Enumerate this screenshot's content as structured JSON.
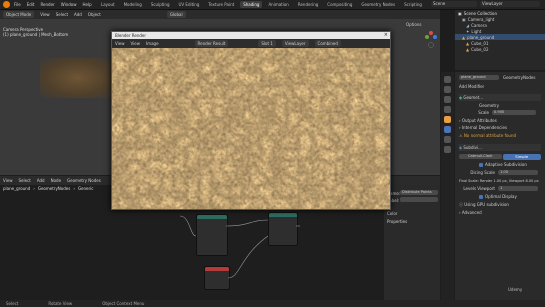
{
  "topbar": {
    "menu": [
      "File",
      "Edit",
      "Render",
      "Window",
      "Help"
    ],
    "workspaces": [
      "Layout",
      "Modeling",
      "Sculpting",
      "UV Editing",
      "Texture Paint",
      "Shading",
      "Animation",
      "Rendering",
      "Compositing",
      "Geometry Nodes",
      "Scripting"
    ],
    "active_workspace": "Shading",
    "scene": "Scene",
    "view_layer": "ViewLayer"
  },
  "viewport": {
    "header_items": [
      "Object Mode",
      "View",
      "Select",
      "Add",
      "Object"
    ],
    "transform": "Global",
    "info_line1": "Camera Perspective",
    "info_line2": "(1) plane_ground | Mesh_Bottom",
    "options_label": "Options"
  },
  "render_window": {
    "title": "Blender Render",
    "header_items": [
      "View",
      "View",
      "Image"
    ],
    "image_name": "Render Result",
    "slot": "Slot 1",
    "view_layer": "ViewLayer",
    "pass": "Combined"
  },
  "node_editor": {
    "header_items": [
      "View",
      "Select",
      "Add",
      "Node"
    ],
    "tree": "Geometry Nodes",
    "breadcrumb": [
      "plane_ground",
      "GeometryNodes",
      "Generic"
    ],
    "panel": {
      "tab": "Node",
      "name_label": "Name:",
      "name_value": "Distribute Points",
      "label_label": "Label:",
      "color_label": "Color",
      "properties_label": "Properties"
    }
  },
  "outliner": {
    "title": "Scene Collection",
    "rows": [
      "Camera_light",
      "Camera",
      "Light",
      "plane_ground",
      "Cube_01",
      "Cube_02"
    ]
  },
  "properties": {
    "object_name": "plane_ground",
    "modifier_label": "GeometryNodes",
    "add_modifier": "Add Modifier",
    "modifiers": [
      {
        "name": "Geomet...",
        "type": "geometry-nodes"
      },
      {
        "name": "Subdivi...",
        "type": "subdivision"
      }
    ],
    "geo_rows": [
      "Geometry",
      "Scale",
      "Output Attributes",
      "Internal Dependencies"
    ],
    "scale_value": "0.900",
    "nomenclature": "No normal attribute found",
    "subdiv": {
      "buttons": [
        "Catmull-Clark",
        "Simple"
      ],
      "adaptive": "Adaptive Subdivision",
      "dicing_label": "Dicing Scale",
      "dicing_value": "1.00",
      "final_scale": "Final Scale: Render 1.00 px, Viewport 8.00 px",
      "levels_label": "Levels Viewport",
      "levels_value": "1",
      "optimal": "Optimal Display",
      "gpu": "Using GPU subdivision",
      "advanced": "Advanced"
    }
  },
  "statusbar": {
    "items": [
      "Select",
      "Rotate View",
      "Object Context Menu"
    ]
  },
  "watermark": "Udemy"
}
